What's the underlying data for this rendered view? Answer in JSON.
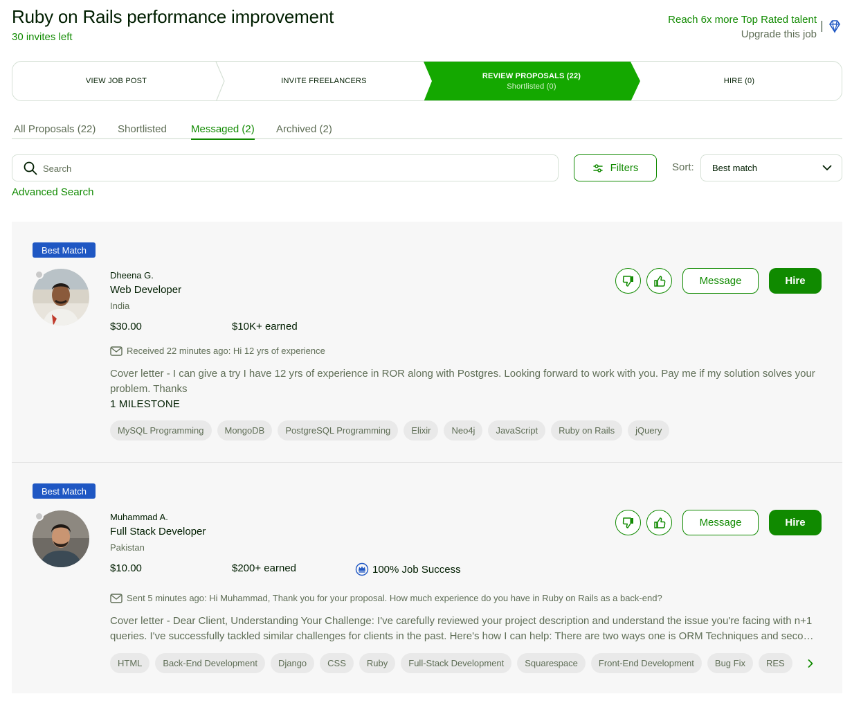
{
  "job": {
    "title": "Ruby on Rails performance improvement",
    "invites_left": "30 invites left",
    "upsell_reach": "Reach 6x more Top Rated talent",
    "upsell_upgrade": "Upgrade this job"
  },
  "steps": [
    {
      "label": "VIEW JOB POST"
    },
    {
      "label": "INVITE FREELANCERS"
    },
    {
      "label": "REVIEW PROPOSALS (22)",
      "sub": "Shortlisted (0)",
      "active": true
    },
    {
      "label": "HIRE (0)"
    }
  ],
  "tabs": [
    {
      "label": "All Proposals (22)"
    },
    {
      "label": "Shortlisted"
    },
    {
      "label": "Messaged (2)",
      "active": true
    },
    {
      "label": "Archived (2)"
    }
  ],
  "search": {
    "placeholder": "Search"
  },
  "filters_label": "Filters",
  "sort": {
    "label": "Sort:",
    "value": "Best match"
  },
  "advanced_search": "Advanced Search",
  "proposals": [
    {
      "badge": "Best Match",
      "name": "Dheena G.",
      "title": "Web Developer",
      "country": "India",
      "rate": "$30.00",
      "earned": "$10K+ earned",
      "message": "Received 22 minutes ago: Hi 12 yrs of experience",
      "cover_letter": "Cover letter - I can give a try I have 12 yrs of experience in ROR along with Postgres. Looking forward to work with you. Pay me if my solution solves your problem. Thanks",
      "milestone": "1 MILESTONE",
      "skills": [
        "MySQL Programming",
        "MongoDB",
        "PostgreSQL Programming",
        "Elixir",
        "Neo4j",
        "JavaScript",
        "Ruby on Rails",
        "jQuery"
      ],
      "message_button": "Message",
      "hire_button": "Hire"
    },
    {
      "badge": "Best Match",
      "name": "Muhammad A.",
      "title": "Full Stack Developer",
      "country": "Pakistan",
      "rate": "$10.00",
      "earned": "$200+ earned",
      "job_success": "100% Job Success",
      "message": "Sent 5 minutes ago: Hi Muhammad, Thank you for your proposal. How much experience do you have in Ruby on Rails as a back-end?",
      "cover_letter": "Cover letter - Dear Client, Understanding Your Challenge: I've carefully reviewed your project description and understand the issue you're facing with n+1 queries. I've successfully tackled similar challenges for clients in the past. Here's how I can help: There are two ways one is ORM Techniques and second is using caching strategies",
      "skills": [
        "HTML",
        "Back-End Development",
        "Django",
        "CSS",
        "Ruby",
        "Full-Stack Development",
        "Squarespace",
        "Front-End Development",
        "Bug Fix",
        "RES"
      ],
      "message_button": "Message",
      "hire_button": "Hire"
    }
  ],
  "colors": {
    "brand_green": "#108a00",
    "badge_blue": "#1f57c3"
  }
}
